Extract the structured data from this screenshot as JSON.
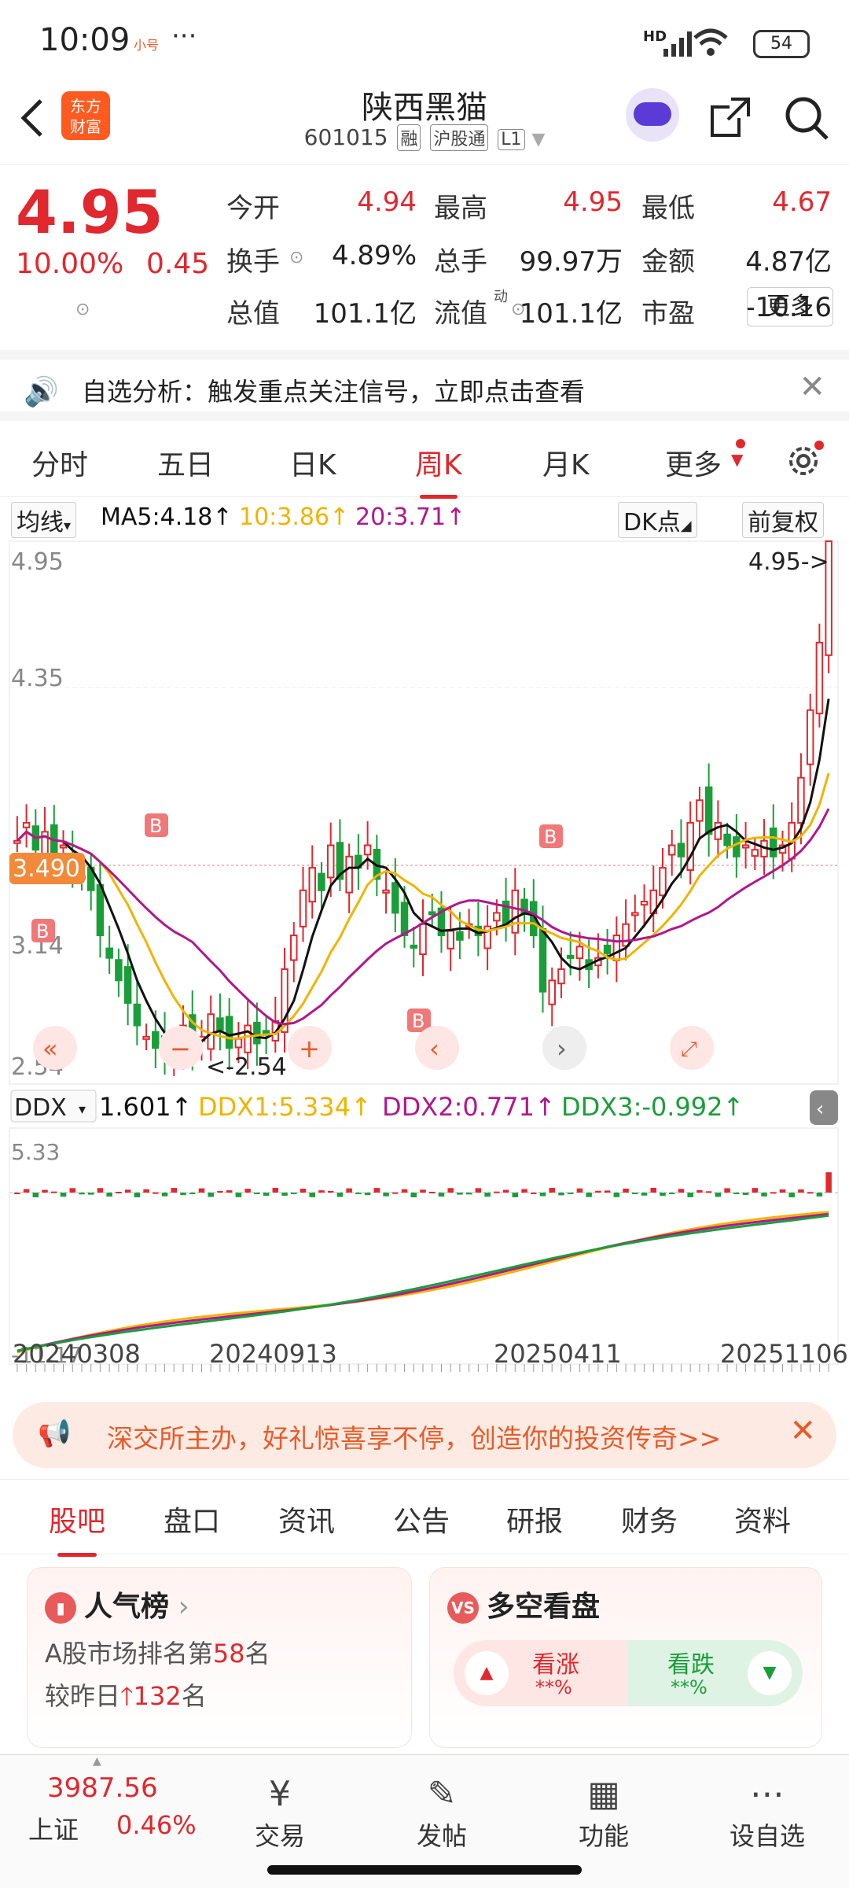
{
  "status": {
    "time": "10:09",
    "small_icon": "小号",
    "dots": "···",
    "net": "HD",
    "battery": "54"
  },
  "header": {
    "logo": "东方\n财富",
    "name": "陕西黑猫",
    "code": "601015",
    "tags": [
      "融",
      "沪股通",
      "L1"
    ]
  },
  "quote": {
    "price": "4.95",
    "change_pct": "10.00%",
    "change_amt": "0.45",
    "cells": [
      {
        "label": "今开",
        "value": "4.94",
        "color": "red"
      },
      {
        "label": "最高",
        "value": "4.95",
        "color": "red"
      },
      {
        "label": "最低",
        "value": "4.67",
        "color": "red"
      },
      {
        "label": "换手",
        "value": "4.89%",
        "color": "black"
      },
      {
        "label": "总手",
        "value": "99.97万",
        "color": "black"
      },
      {
        "label": "金额",
        "value": "4.87亿",
        "color": "black"
      },
      {
        "label": "总值",
        "value": "101.1亿",
        "color": "black"
      },
      {
        "label": "流值",
        "value": "101.1亿",
        "color": "black"
      },
      {
        "label": "市盈",
        "value": "-10.16",
        "color": "black"
      }
    ],
    "pe_sup": "动",
    "more": "更多"
  },
  "notice": {
    "text": "自选分析：触发重点关注信号，立即点击查看"
  },
  "period_tabs": [
    "分时",
    "五日",
    "日K",
    "周K",
    "月K",
    "更多"
  ],
  "period_active": 3,
  "ma": {
    "selector": "均线",
    "ma5": "MA5:4.18↑",
    "ma10": "10:3.86↑",
    "ma20": "20:3.71↑",
    "dk": "DK点",
    "fq": "前复权"
  },
  "chart_labels": {
    "price_high": "4.95",
    "price_mid": "4.35",
    "price_low1": "3.14",
    "price_low": "2.54",
    "cur_price": "3.490",
    "max_marker": "4.95->",
    "min_marker": "<-2.54",
    "b_marker": "B"
  },
  "ddx": {
    "selector": "DDX",
    "ddx": "1.601↑",
    "ddx1": "DDX1:5.334↑",
    "ddx2": "DDX2:0.771↑",
    "ddx3": "DDX3:-0.992↑",
    "top": "5.33",
    "bottom": "-11.17"
  },
  "dates": [
    "20240308",
    "20240913",
    "20250411",
    "20251106"
  ],
  "colors": {
    "up": "#e0282e",
    "down": "#1a9e3a",
    "ma5": "#111111",
    "ma10": "#f0b400",
    "ma20": "#b0188c",
    "accent": "#ff5a1f"
  },
  "banner": {
    "text": "深交所主办，好礼惊喜享不停，创造你的投资传奇>>"
  },
  "section_tabs": [
    "股吧",
    "盘口",
    "资讯",
    "公告",
    "研报",
    "财务",
    "资料"
  ],
  "section_active": 0,
  "popularity": {
    "title": "人气榜",
    "rank_prefix": "A股市场排名第",
    "rank": "58",
    "rank_suffix": "名",
    "change_prefix": "较昨日",
    "change": "132",
    "change_suffix": "名"
  },
  "bullbear": {
    "title": "多空看盘",
    "up_label": "看涨",
    "up_value": "**%",
    "down_label": "看跌",
    "down_value": "**%"
  },
  "bottom_nav": {
    "index_value": "3987.56",
    "index_name": "上证",
    "index_change": "0.46%",
    "items": [
      "交易",
      "发帖",
      "功能",
      "设自选"
    ]
  }
}
